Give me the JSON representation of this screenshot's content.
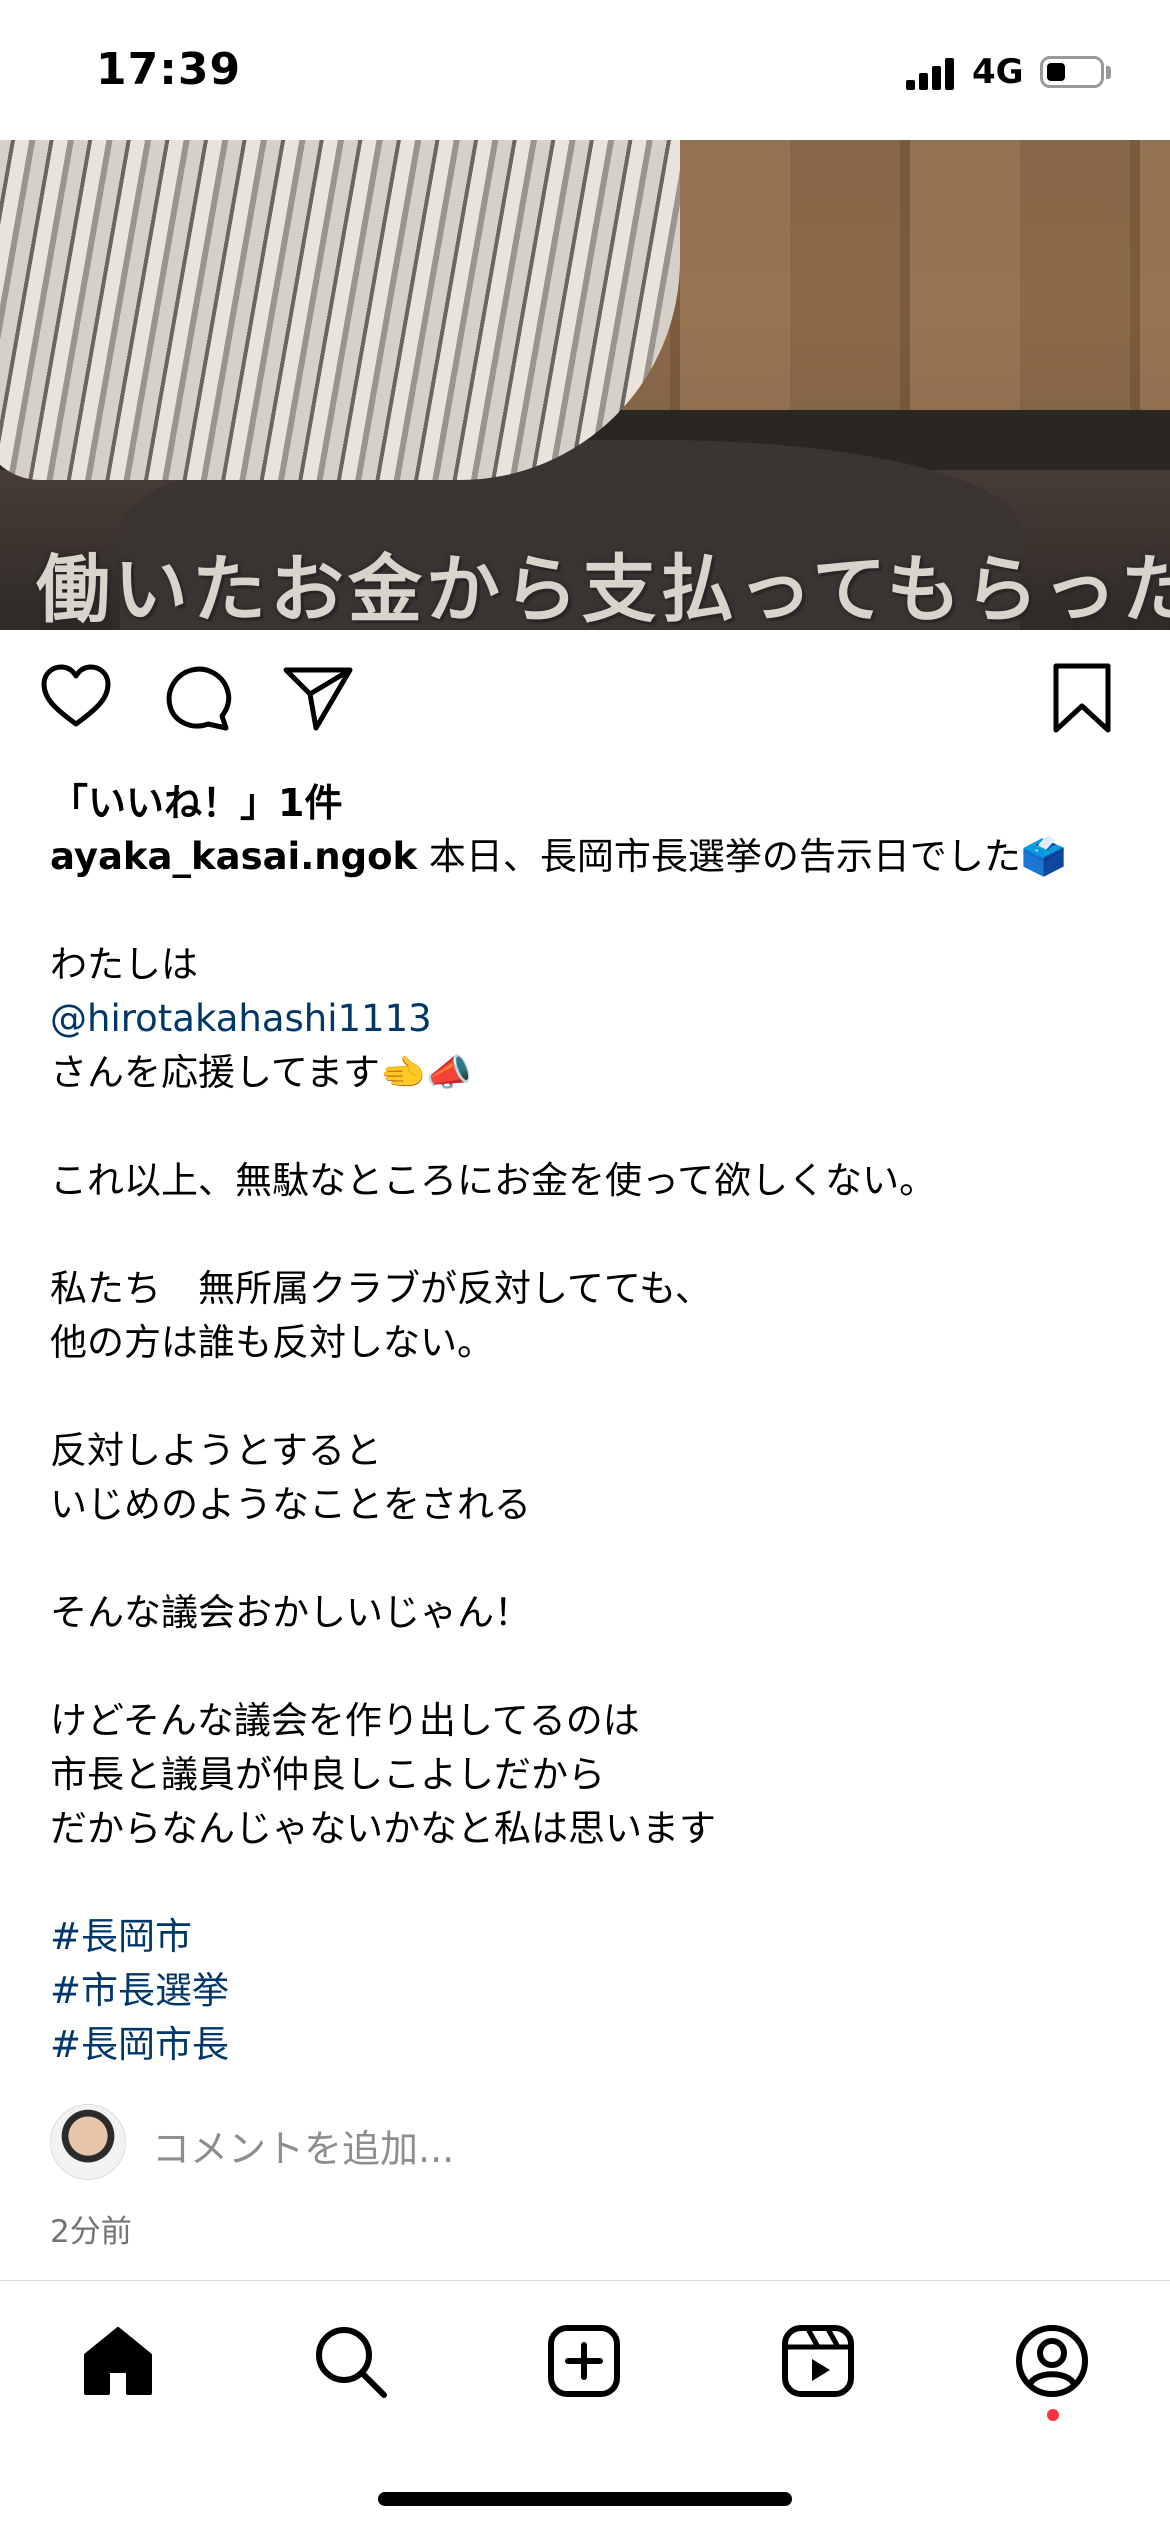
{
  "status_bar": {
    "time": "17:39",
    "network": "4G",
    "battery_level": 0.35
  },
  "video": {
    "overlay_text": "働いたお金から支払ってもらった",
    "muted": true
  },
  "post": {
    "likes_text": "「いいね！」1件",
    "username": "ayaka_kasai.ngok",
    "caption_first_line": "本日、長岡市長選挙の告示日でした🗳️",
    "caption_lines": [
      "",
      "わたしは",
      "@hirotakahashi1113",
      "さんを応援してます🫲📣",
      "",
      "これ以上、無駄なところにお金を使って欲しくない。",
      "",
      "私たち　無所属クラブが反対してても、",
      "他の方は誰も反対しない。",
      "",
      "反対しようとすると",
      "いじめのようなことをされる",
      "",
      "そんな議会おかしいじゃん！",
      "",
      "けどそんな議会を作り出してるのは",
      "市長と議員が仲良しこよしだから",
      "だからなんじゃないかなと私は思います",
      "",
      "#長岡市",
      "#市長選挙",
      "#長岡市長"
    ],
    "comment_placeholder": "コメントを追加...",
    "timestamp": "2分前"
  },
  "icons": {
    "like": "heart-icon",
    "comment": "comment-icon",
    "share": "send-icon",
    "save": "bookmark-icon",
    "mute": "speaker-muted-icon"
  },
  "tab_bar": [
    "home-icon",
    "search-icon",
    "create-icon",
    "reels-icon",
    "profile-icon"
  ],
  "colors": {
    "link": "#00376b",
    "notification": "#ff3040",
    "secondary_text": "#8e8e8e"
  }
}
